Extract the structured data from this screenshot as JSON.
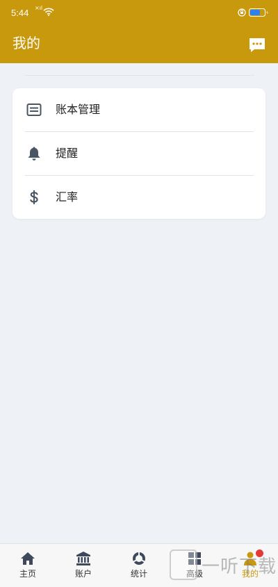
{
  "status": {
    "time": "5:44",
    "signal": "×ıl"
  },
  "header": {
    "title": "我的"
  },
  "menu": [
    {
      "label": "账本管理",
      "icon": "ledger-icon"
    },
    {
      "label": "提醒",
      "icon": "bell-icon"
    },
    {
      "label": "汇率",
      "icon": "dollar-icon"
    }
  ],
  "nav": [
    {
      "label": "主页",
      "icon": "home-icon"
    },
    {
      "label": "账户",
      "icon": "bank-icon"
    },
    {
      "label": "统计",
      "icon": "stats-icon"
    },
    {
      "label": "高级",
      "icon": "grid-icon"
    },
    {
      "label": "我的",
      "icon": "person-icon",
      "active": true
    }
  ],
  "watermark": {
    "text": "一听下载"
  },
  "colors": {
    "brand": "#c9990d",
    "active_nav": "#c9990d",
    "badge": "#e53935"
  }
}
